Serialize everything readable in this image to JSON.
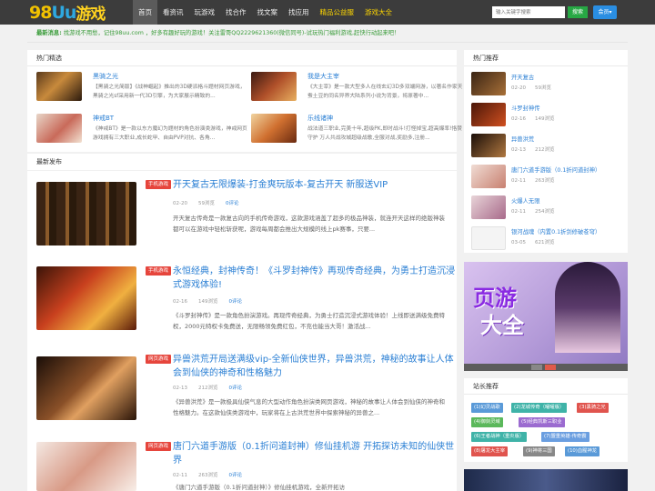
{
  "header": {
    "logo": {
      "part1": "98",
      "part2": "Uu",
      "part3": "游戏"
    },
    "nav": [
      {
        "label": "首页",
        "active": true
      },
      {
        "label": "看资讯"
      },
      {
        "label": "玩游戏"
      },
      {
        "label": "找合作"
      },
      {
        "label": "找文案"
      },
      {
        "label": "找应用"
      },
      {
        "label": "精品公益服",
        "highlight": true
      },
      {
        "label": "游戏大全",
        "highlight": true
      }
    ],
    "search": {
      "placeholder": "输入关键字搜索",
      "button": "搜索"
    },
    "member_button": "会员▾"
  },
  "notice": {
    "label": "最新消息:",
    "text": "找游戏不用愁，记住98uu.com ，好多有趣好玩的游戏！关注雷哥QQ2229621360(微信同号)-试玩热门福利游戏,赶快行动起来吧！"
  },
  "hot": {
    "title": "热门精选",
    "items": [
      {
        "title": "黑骑之光",
        "desc": "【黑骑之光简版】《战神崛起》推出的3D硬派格斗题材网页游戏，黑骑之光sf采用新一代3D引擎，为大家展示精致的..."
      },
      {
        "title": "我是大主宰",
        "desc": "《大主宰》是一款大型多人在线玄幻3D多双端网游，以著名作家天蚕土豆的同名异界大陆系列小说为背景，将原著中..."
      },
      {
        "title": "神戒BT",
        "desc": "《神戒BT》是一款以东方魔幻为题材的角色扮演类游戏，神戒网页游戏拥有三大职业,成长蛇甲、自由PVP对抗、各角..."
      },
      {
        "title": "乐线诸神",
        "desc": "战法道三职业,完美十年,超级PK,即时战斗!打怪掉宝,超高爆率!恪赞守护 万人共战攻城超级战歌,全服对战,奖励多,注册..."
      }
    ]
  },
  "latest": {
    "title": "最新发布",
    "articles": [
      {
        "badge": "手机游戏",
        "title": "开天复古无限爆装-打金爽玩版本-复古开天 新服送VIP",
        "date": "02-20",
        "views": "59浏览",
        "comments": "0评论",
        "desc": "开天复古传奇是一款复古向的手机传奇游戏，这款游戏涵盖了超多的极品神装，就连开天这样的绝版神装都可以在游戏中轻松斩获呢，游戏每周都会推出大规模的线上pk赛事，只要..."
      },
      {
        "badge": "手机游戏",
        "title": "永恒经典，封神传奇！《斗罗封神传》再现传奇经典，为勇士打造沉浸式游戏体验!",
        "date": "02-16",
        "views": "149浏览",
        "comments": "0评论",
        "desc": "《斗罗封神传》是一款角色扮演游戏。再现传奇经典，为勇士打造沉浸式游戏体验！上线即送满级免费特权，2000元特权卡免费送，无限畅领免费红包，不充也能当大哥！激活战..."
      },
      {
        "badge": "网页游戏",
        "title": "异兽洪荒开局送满级vip-全新仙侠世界，异兽洪荒，神秘的故事让人体会到仙侠的神奇和性格魅力",
        "date": "02-13",
        "views": "212浏览",
        "comments": "0评论",
        "desc": "《异兽洪荒》是一款极具仙侠气息的大型动作角色扮演类网页游戏，神秘的故事让人体会到仙侠的神奇和性格魅力。在这款仙侠类游戏中，玩家将在上古洪荒世界中探索神秘的异兽之..."
      },
      {
        "badge": "网页游戏",
        "title": "唐门六道手游版（0.1折问道封神）修仙挂机游 开拓探访未知的仙侠世界",
        "date": "02-11",
        "views": "263浏览",
        "comments": "0评论",
        "desc": "《唐门六道手游版（0.1折问道封神）》修仙挂机游戏，全新开拓访"
      }
    ]
  },
  "sidebar": {
    "rec_title": "热门推荐",
    "rec": [
      {
        "title": "开天复古",
        "date": "02-20",
        "views": "59浏览"
      },
      {
        "title": "斗罗封神传",
        "date": "02-16",
        "views": "149浏览"
      },
      {
        "title": "异兽洪荒",
        "date": "02-13",
        "views": "212浏览"
      },
      {
        "title": "唐门六道手游版（0.1折问道封神）",
        "date": "02-11",
        "views": "263浏览"
      },
      {
        "title": "火爆人无限",
        "date": "02-11",
        "views": "254浏览"
      },
      {
        "title": "银河战魂（内置0.1折剑修破苍穹）",
        "date": "03-05",
        "views": "621浏览"
      }
    ],
    "banner": {
      "line1": "页游",
      "line2": "大全"
    },
    "tags_title": "站长推荐",
    "tags": [
      {
        "label": "(1)幻灵战歌",
        "color": "#5a9ad8"
      },
      {
        "label": "(2)龙城传奇（曜曜版）",
        "color": "#3fb3a8"
      },
      {
        "label": "(3)黑骑之光",
        "color": "#e0544e"
      },
      {
        "label": "(4)御剑灵域",
        "color": "#5bb85b"
      },
      {
        "label": "(5)经典凯斯三职业",
        "color": "#9b6bd0"
      },
      {
        "label": "(6)王者战神（重炎版）",
        "color": "#3fb3a8"
      },
      {
        "label": "(7)盟重英雄-传奇霸",
        "color": "#6a9ee0"
      },
      {
        "label": "(8)屠龙大主宰",
        "color": "#e0544e"
      },
      {
        "label": "(9)神将三国",
        "color": "#888888"
      },
      {
        "label": "(10)血腥神龙",
        "color": "#5a9ad8"
      }
    ]
  }
}
